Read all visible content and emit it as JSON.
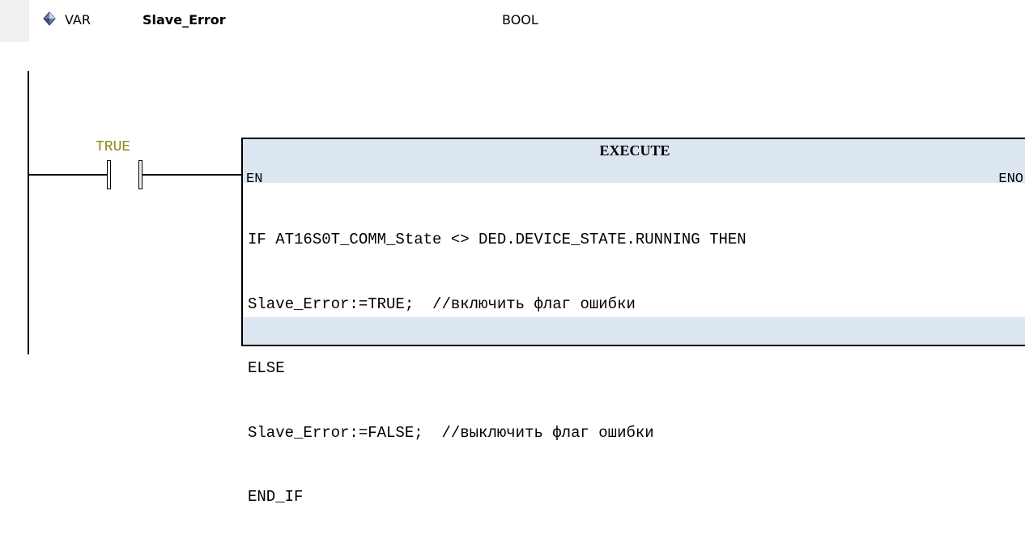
{
  "variable": {
    "kind": "VAR",
    "name": "Slave_Error",
    "type": "BOOL",
    "icon": "variable-diamond-icon"
  },
  "contact": {
    "label": "TRUE"
  },
  "execute_block": {
    "title": "EXECUTE",
    "pin_in": "EN",
    "pin_out": "ENO",
    "code": [
      "IF AT16S0T_COMM_State <> DED.DEVICE_STATE.RUNNING THEN",
      "Slave_Error:=TRUE;  //включить флаг ошибки",
      "ELSE",
      "Slave_Error:=FALSE;  //выключить флаг ошибки",
      "END_IF"
    ]
  },
  "colors": {
    "block_background": "#dce6f1",
    "contact_label": "#8a8a10",
    "gutter": "#f0f0f0"
  }
}
